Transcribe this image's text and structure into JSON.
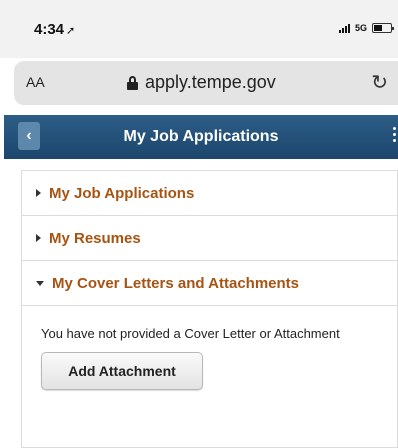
{
  "status_bar": {
    "time": "4:34",
    "network": "5G"
  },
  "browser": {
    "text_size_label": "AA",
    "url": "apply.tempe.gov",
    "reload_glyph": "↻"
  },
  "header": {
    "back_glyph": "‹",
    "title": "My Job Applications"
  },
  "accordion": {
    "items": [
      {
        "label": "My Job Applications",
        "expanded": false
      },
      {
        "label": "My Resumes",
        "expanded": false
      },
      {
        "label": "My Cover Letters and Attachments",
        "expanded": true
      }
    ]
  },
  "cover_letters": {
    "message": "You have not provided a Cover Letter or Attachment",
    "add_button_label": "Add Attachment"
  },
  "colors": {
    "header_bg": "#1c466d",
    "link_orange": "#a65413"
  }
}
